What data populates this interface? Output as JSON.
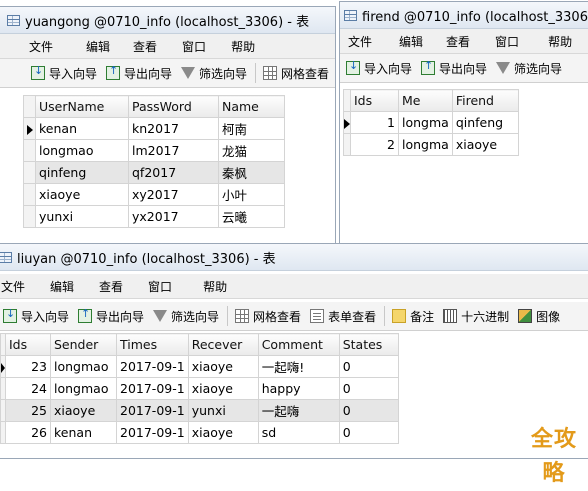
{
  "windows": {
    "yuangong": {
      "title": "yuangong @0710_info (localhost_3306) - 表",
      "menu": [
        "文件",
        "编辑",
        "查看",
        "窗口",
        "帮助"
      ],
      "toolbar": {
        "import": "导入向导",
        "export": "导出向导",
        "filter": "筛选向导",
        "grid": "网格查看"
      },
      "columns": [
        "UserName",
        "PassWord",
        "Name"
      ],
      "rows": [
        [
          "kenan",
          "kn2017",
          "柯南"
        ],
        [
          "longmao",
          "lm2017",
          "龙猫"
        ],
        [
          "qinfeng",
          "qf2017",
          "秦枫"
        ],
        [
          "xiaoye",
          "xy2017",
          "小叶"
        ],
        [
          "yunxi",
          "yx2017",
          "云曦"
        ]
      ]
    },
    "firend": {
      "title": "firend @0710_info (localhost_3306) - 表",
      "menu": [
        "文件",
        "编辑",
        "查看",
        "窗口",
        "帮助"
      ],
      "toolbar": {
        "import": "导入向导",
        "export": "导出向导",
        "filter": "筛选向导"
      },
      "columns": [
        "Ids",
        "Me",
        "Firend"
      ],
      "rows": [
        [
          "1",
          "longma",
          "qinfeng"
        ],
        [
          "2",
          "longma",
          "xiaoye"
        ]
      ]
    },
    "liuyan": {
      "title": "liuyan @0710_info (localhost_3306) - 表",
      "menu": [
        "文件",
        "编辑",
        "查看",
        "窗口",
        "帮助"
      ],
      "toolbar": {
        "import": "导入向导",
        "export": "导出向导",
        "filter": "筛选向导",
        "grid": "网格查看",
        "form": "表单查看",
        "note": "备注",
        "hex": "十六进制",
        "image": "图像"
      },
      "columns": [
        "Ids",
        "Sender",
        "Times",
        "Recever",
        "Comment",
        "States"
      ],
      "rows": [
        [
          "23",
          "longmao",
          "2017-09-1",
          "xiaoye",
          "一起嗨!",
          "0"
        ],
        [
          "24",
          "longmao",
          "2017-09-1",
          "xiaoye",
          "happy",
          "0"
        ],
        [
          "25",
          "xiaoye",
          "2017-09-1",
          "yunxi",
          "一起嗨",
          "0"
        ],
        [
          "26",
          "kenan",
          "2017-09-1",
          "xiaoye",
          "sd",
          "0"
        ]
      ]
    }
  },
  "watermark": "全攻略"
}
